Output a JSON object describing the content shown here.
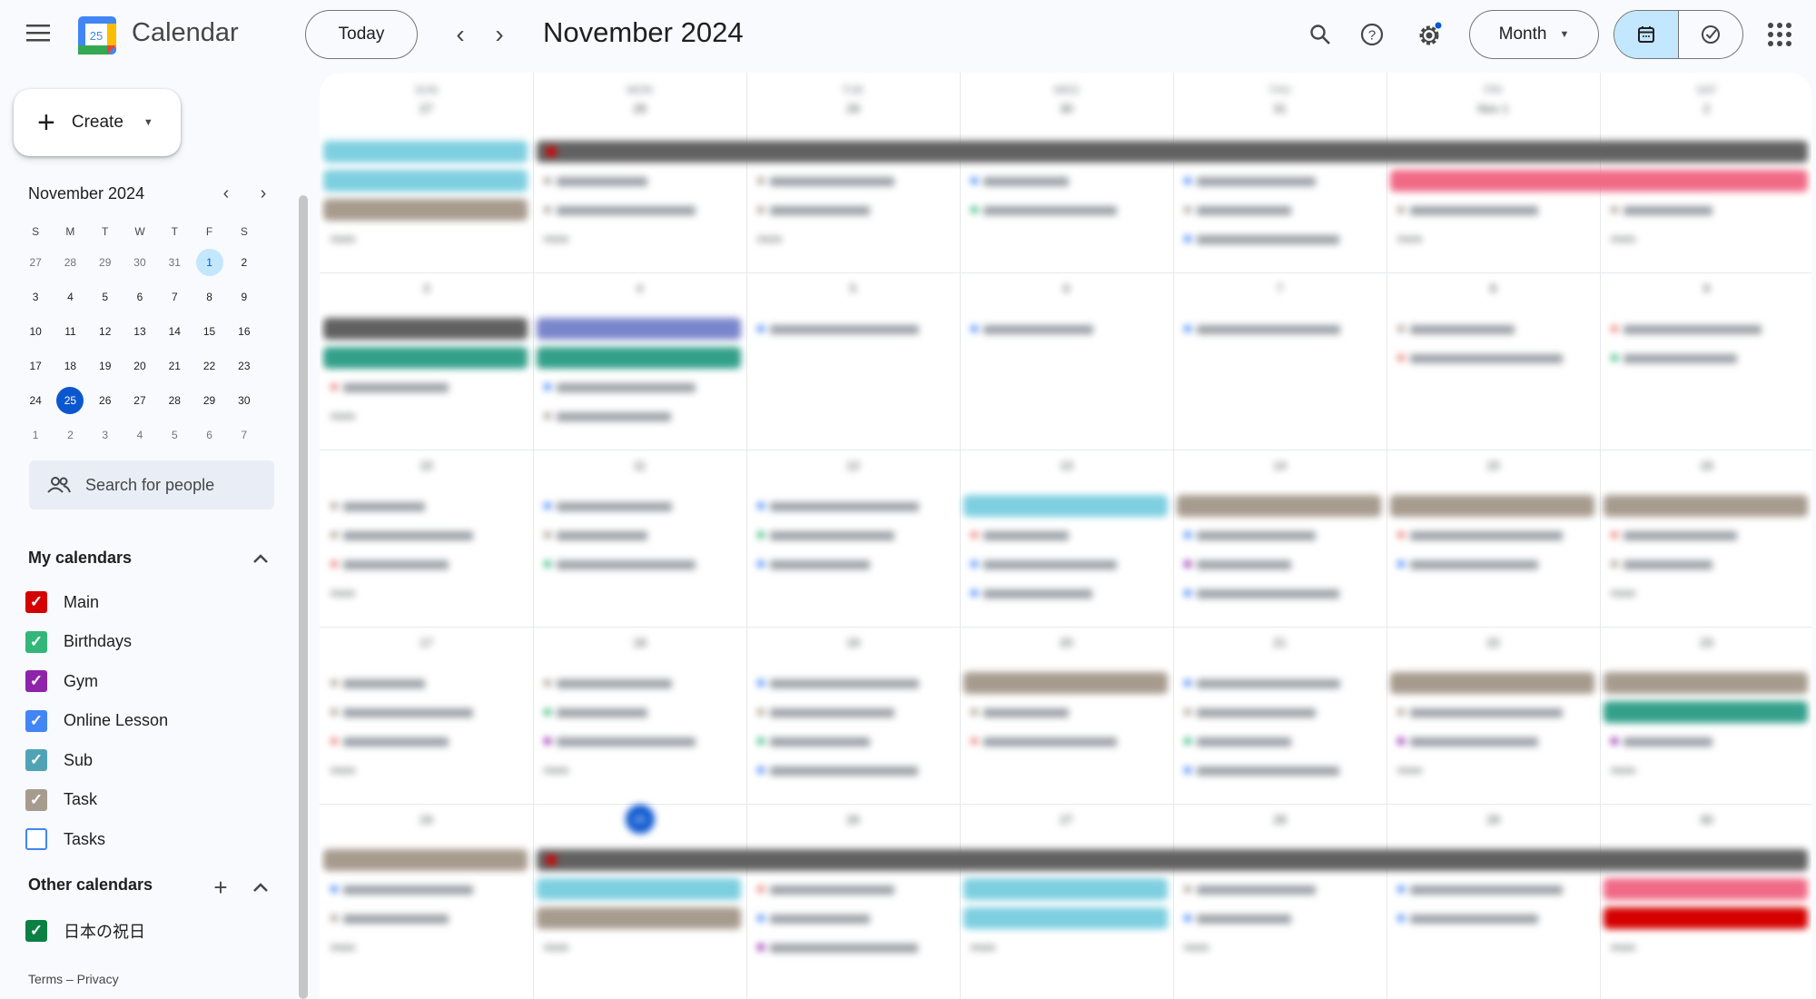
{
  "app": {
    "title": "Calendar",
    "logo_day": "25"
  },
  "toolbar": {
    "today_label": "Today",
    "period_title": "November 2024",
    "view_label": "Month",
    "icons": [
      "menu-icon",
      "search-icon",
      "help-icon",
      "settings-icon",
      "calendar-view-icon",
      "tasks-view-icon",
      "apps-grid-icon"
    ]
  },
  "sidebar": {
    "create_label": "Create",
    "mini_calendar": {
      "title": "November 2024",
      "weekdays": [
        "S",
        "M",
        "T",
        "W",
        "T",
        "F",
        "S"
      ],
      "weeks": [
        [
          "27",
          "28",
          "29",
          "30",
          "31",
          "1",
          "2"
        ],
        [
          "3",
          "4",
          "5",
          "6",
          "7",
          "8",
          "9"
        ],
        [
          "10",
          "11",
          "12",
          "13",
          "14",
          "15",
          "16"
        ],
        [
          "17",
          "18",
          "19",
          "20",
          "21",
          "22",
          "23"
        ],
        [
          "24",
          "25",
          "26",
          "27",
          "28",
          "29",
          "30"
        ],
        [
          "1",
          "2",
          "3",
          "4",
          "5",
          "6",
          "7"
        ]
      ],
      "selected": "1",
      "today": "25"
    },
    "people_search_placeholder": "Search for people",
    "my_calendars_label": "My calendars",
    "my_calendars": [
      {
        "name": "Main",
        "color": "#d50000",
        "checked": true
      },
      {
        "name": "Birthdays",
        "color": "#33b679",
        "checked": true
      },
      {
        "name": "Gym",
        "color": "#8e24aa",
        "checked": true
      },
      {
        "name": "Online Lesson",
        "color": "#4285f4",
        "checked": true
      },
      {
        "name": "Sub",
        "color": "#4fa3b5",
        "checked": true
      },
      {
        "name": "Task",
        "color": "#a79b8e",
        "checked": true
      },
      {
        "name": "Tasks",
        "color": "#4285f4",
        "checked": false
      }
    ],
    "other_calendars_label": "Other calendars",
    "other_calendars": [
      {
        "name": "日本の祝日",
        "color": "#0b8043",
        "checked": true
      }
    ],
    "footer": "Terms – Privacy"
  },
  "month_grid": {
    "weekday_names": [
      "SUN",
      "MON",
      "TUE",
      "WED",
      "THU",
      "FRI",
      "SAT"
    ],
    "weeks": [
      [
        "27",
        "28",
        "29",
        "30",
        "31",
        "Nov 1",
        "2"
      ],
      [
        "3",
        "4",
        "5",
        "6",
        "7",
        "8",
        "9"
      ],
      [
        "10",
        "11",
        "12",
        "13",
        "14",
        "15",
        "16"
      ],
      [
        "17",
        "18",
        "19",
        "20",
        "21",
        "22",
        "23"
      ],
      [
        "24",
        "25",
        "26",
        "27",
        "28",
        "29",
        "30"
      ]
    ],
    "today_cell": [
      4,
      1
    ],
    "colors": {
      "gray": "#616161",
      "teal": "#7dcfe0",
      "task": "#a79b8e",
      "pink": "#e67c73",
      "rose": "#f06a86",
      "green": "#33a08a",
      "lavender": "#7986cb",
      "red": "#d50000",
      "blue": "#4285f4",
      "purple": "#8e24aa",
      "lightgreen": "#33b679"
    },
    "spans": [
      {
        "week": 0,
        "start": 1,
        "end": 6,
        "slot": 0,
        "color": "gray",
        "text": ""
      },
      {
        "week": 0,
        "start": 5,
        "end": 6,
        "slot": 1,
        "color": "rose",
        "text": ""
      },
      {
        "week": 4,
        "start": 1,
        "end": 6,
        "slot": 0,
        "color": "gray",
        "text": ""
      }
    ],
    "chips": [
      {
        "week": 0,
        "day": 0,
        "slot": 0,
        "color": "teal",
        "text": ""
      },
      {
        "week": 0,
        "day": 0,
        "slot": 1,
        "color": "teal",
        "text": ""
      },
      {
        "week": 0,
        "day": 0,
        "slot": 2,
        "color": "task",
        "text": ""
      },
      {
        "week": 1,
        "day": 0,
        "slot": 0,
        "color": "gray",
        "text": ""
      },
      {
        "week": 1,
        "day": 0,
        "slot": 1,
        "color": "green",
        "text": ""
      },
      {
        "week": 1,
        "day": 1,
        "slot": 0,
        "color": "lavender",
        "text": ""
      },
      {
        "week": 1,
        "day": 1,
        "slot": 1,
        "color": "green",
        "text": ""
      },
      {
        "week": 2,
        "day": 3,
        "slot": 0,
        "color": "teal",
        "text": ""
      },
      {
        "week": 2,
        "day": 4,
        "slot": 0,
        "color": "task",
        "text": ""
      },
      {
        "week": 2,
        "day": 5,
        "slot": 0,
        "color": "task",
        "text": ""
      },
      {
        "week": 2,
        "day": 6,
        "slot": 0,
        "color": "task",
        "text": ""
      },
      {
        "week": 3,
        "day": 3,
        "slot": 0,
        "color": "task",
        "text": ""
      },
      {
        "week": 3,
        "day": 5,
        "slot": 0,
        "color": "task",
        "text": ""
      },
      {
        "week": 3,
        "day": 6,
        "slot": 0,
        "color": "task",
        "text": ""
      },
      {
        "week": 3,
        "day": 6,
        "slot": 1,
        "color": "green",
        "text": ""
      },
      {
        "week": 4,
        "day": 0,
        "slot": 0,
        "color": "task",
        "text": ""
      },
      {
        "week": 4,
        "day": 1,
        "slot": 1,
        "color": "teal",
        "text": ""
      },
      {
        "week": 4,
        "day": 1,
        "slot": 2,
        "color": "task",
        "text": ""
      },
      {
        "week": 4,
        "day": 3,
        "slot": 1,
        "color": "teal",
        "text": ""
      },
      {
        "week": 4,
        "day": 3,
        "slot": 2,
        "color": "teal",
        "text": ""
      },
      {
        "week": 4,
        "day": 6,
        "slot": 1,
        "color": "rose",
        "text": ""
      },
      {
        "week": 4,
        "day": 6,
        "slot": 2,
        "color": "red",
        "text": ""
      }
    ],
    "lines": [
      {
        "week": 0,
        "day": 1,
        "slot": 1,
        "color": "task"
      },
      {
        "week": 0,
        "day": 1,
        "slot": 2,
        "color": "task"
      },
      {
        "week": 0,
        "day": 2,
        "slot": 1,
        "color": "task"
      },
      {
        "week": 0,
        "day": 2,
        "slot": 2,
        "color": "task"
      },
      {
        "week": 0,
        "day": 3,
        "slot": 1,
        "color": "blue"
      },
      {
        "week": 0,
        "day": 3,
        "slot": 2,
        "color": "lightgreen"
      },
      {
        "week": 0,
        "day": 4,
        "slot": 1,
        "color": "blue"
      },
      {
        "week": 0,
        "day": 4,
        "slot": 2,
        "color": "task"
      },
      {
        "week": 0,
        "day": 4,
        "slot": 3,
        "color": "blue"
      },
      {
        "week": 0,
        "day": 5,
        "slot": 2,
        "color": "task"
      },
      {
        "week": 0,
        "day": 6,
        "slot": 2,
        "color": "task"
      },
      {
        "week": 1,
        "day": 0,
        "slot": 2,
        "color": "pink"
      },
      {
        "week": 1,
        "day": 1,
        "slot": 2,
        "color": "blue"
      },
      {
        "week": 1,
        "day": 1,
        "slot": 3,
        "color": "task"
      },
      {
        "week": 1,
        "day": 2,
        "slot": 0,
        "color": "blue"
      },
      {
        "week": 1,
        "day": 3,
        "slot": 0,
        "color": "blue"
      },
      {
        "week": 1,
        "day": 4,
        "slot": 0,
        "color": "blue"
      },
      {
        "week": 1,
        "day": 5,
        "slot": 0,
        "color": "task"
      },
      {
        "week": 1,
        "day": 5,
        "slot": 1,
        "color": "pink"
      },
      {
        "week": 1,
        "day": 6,
        "slot": 0,
        "color": "pink"
      },
      {
        "week": 1,
        "day": 6,
        "slot": 1,
        "color": "lightgreen"
      },
      {
        "week": 2,
        "day": 0,
        "slot": 0,
        "color": "task"
      },
      {
        "week": 2,
        "day": 0,
        "slot": 1,
        "color": "task"
      },
      {
        "week": 2,
        "day": 0,
        "slot": 2,
        "color": "pink"
      },
      {
        "week": 2,
        "day": 1,
        "slot": 0,
        "color": "blue"
      },
      {
        "week": 2,
        "day": 1,
        "slot": 1,
        "color": "task"
      },
      {
        "week": 2,
        "day": 1,
        "slot": 2,
        "color": "lightgreen"
      },
      {
        "week": 2,
        "day": 2,
        "slot": 0,
        "color": "blue"
      },
      {
        "week": 2,
        "day": 2,
        "slot": 1,
        "color": "lightgreen"
      },
      {
        "week": 2,
        "day": 2,
        "slot": 2,
        "color": "blue"
      },
      {
        "week": 2,
        "day": 3,
        "slot": 1,
        "color": "pink"
      },
      {
        "week": 2,
        "day": 3,
        "slot": 2,
        "color": "blue"
      },
      {
        "week": 2,
        "day": 3,
        "slot": 3,
        "color": "blue"
      },
      {
        "week": 2,
        "day": 4,
        "slot": 1,
        "color": "blue"
      },
      {
        "week": 2,
        "day": 4,
        "slot": 2,
        "color": "purple"
      },
      {
        "week": 2,
        "day": 4,
        "slot": 3,
        "color": "blue"
      },
      {
        "week": 2,
        "day": 5,
        "slot": 1,
        "color": "pink"
      },
      {
        "week": 2,
        "day": 5,
        "slot": 2,
        "color": "blue"
      },
      {
        "week": 2,
        "day": 6,
        "slot": 1,
        "color": "pink"
      },
      {
        "week": 2,
        "day": 6,
        "slot": 2,
        "color": "task"
      },
      {
        "week": 3,
        "day": 0,
        "slot": 0,
        "color": "task"
      },
      {
        "week": 3,
        "day": 0,
        "slot": 1,
        "color": "task"
      },
      {
        "week": 3,
        "day": 0,
        "slot": 2,
        "color": "pink"
      },
      {
        "week": 3,
        "day": 1,
        "slot": 0,
        "color": "task"
      },
      {
        "week": 3,
        "day": 1,
        "slot": 1,
        "color": "lightgreen"
      },
      {
        "week": 3,
        "day": 1,
        "slot": 2,
        "color": "purple"
      },
      {
        "week": 3,
        "day": 2,
        "slot": 0,
        "color": "blue"
      },
      {
        "week": 3,
        "day": 2,
        "slot": 1,
        "color": "task"
      },
      {
        "week": 3,
        "day": 2,
        "slot": 2,
        "color": "lightgreen"
      },
      {
        "week": 3,
        "day": 2,
        "slot": 3,
        "color": "blue"
      },
      {
        "week": 3,
        "day": 3,
        "slot": 1,
        "color": "task"
      },
      {
        "week": 3,
        "day": 3,
        "slot": 2,
        "color": "pink"
      },
      {
        "week": 3,
        "day": 4,
        "slot": 0,
        "color": "blue"
      },
      {
        "week": 3,
        "day": 4,
        "slot": 1,
        "color": "task"
      },
      {
        "week": 3,
        "day": 4,
        "slot": 2,
        "color": "lightgreen"
      },
      {
        "week": 3,
        "day": 4,
        "slot": 3,
        "color": "blue"
      },
      {
        "week": 3,
        "day": 5,
        "slot": 1,
        "color": "task"
      },
      {
        "week": 3,
        "day": 5,
        "slot": 2,
        "color": "purple"
      },
      {
        "week": 3,
        "day": 6,
        "slot": 2,
        "color": "purple"
      },
      {
        "week": 4,
        "day": 0,
        "slot": 1,
        "color": "blue"
      },
      {
        "week": 4,
        "day": 0,
        "slot": 2,
        "color": "task"
      },
      {
        "week": 4,
        "day": 2,
        "slot": 1,
        "color": "pink"
      },
      {
        "week": 4,
        "day": 2,
        "slot": 2,
        "color": "blue"
      },
      {
        "week": 4,
        "day": 2,
        "slot": 3,
        "color": "purple"
      },
      {
        "week": 4,
        "day": 4,
        "slot": 1,
        "color": "task"
      },
      {
        "week": 4,
        "day": 4,
        "slot": 2,
        "color": "blue"
      },
      {
        "week": 4,
        "day": 5,
        "slot": 1,
        "color": "blue"
      },
      {
        "week": 4,
        "day": 5,
        "slot": 2,
        "color": "blue"
      }
    ],
    "more": [
      {
        "week": 0,
        "day": 0,
        "slot": 3
      },
      {
        "week": 0,
        "day": 1,
        "slot": 3
      },
      {
        "week": 0,
        "day": 2,
        "slot": 3
      },
      {
        "week": 0,
        "day": 5,
        "slot": 3
      },
      {
        "week": 0,
        "day": 6,
        "slot": 3
      },
      {
        "week": 1,
        "day": 0,
        "slot": 3
      },
      {
        "week": 2,
        "day": 0,
        "slot": 3
      },
      {
        "week": 2,
        "day": 6,
        "slot": 3
      },
      {
        "week": 3,
        "day": 0,
        "slot": 3
      },
      {
        "week": 3,
        "day": 1,
        "slot": 3
      },
      {
        "week": 3,
        "day": 5,
        "slot": 3
      },
      {
        "week": 3,
        "day": 6,
        "slot": 3
      },
      {
        "week": 4,
        "day": 0,
        "slot": 3
      },
      {
        "week": 4,
        "day": 1,
        "slot": 3
      },
      {
        "week": 4,
        "day": 3,
        "slot": 3
      },
      {
        "week": 4,
        "day": 4,
        "slot": 3
      },
      {
        "week": 4,
        "day": 6,
        "slot": 3
      }
    ],
    "more_text": "more"
  }
}
